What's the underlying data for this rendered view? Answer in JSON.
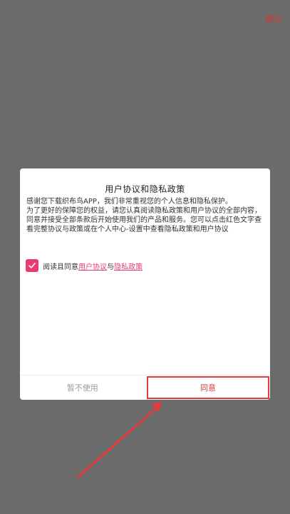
{
  "header": {
    "skip_label": "跳过"
  },
  "dialog": {
    "title": "用户协议和隐私政策",
    "paragraph1": "感谢您下载织布鸟APP，我们非常重视您的个人信息和隐私保护。",
    "paragraph2": "为了更好的保障您的权益，请您认真阅读隐私政策和用户协议的全部内容，同意并接受全部条款后开始使用我们的产品和服务。您可以点击红色文字查看完整协议与政策或在个人中心-设置中查看隐私政策和用户协议",
    "consent": {
      "prefix": "阅读且同意",
      "user_agreement": "用户协议",
      "connector": "与",
      "privacy_policy": "隐私政策",
      "checked": true
    },
    "buttons": {
      "decline": "暂不使用",
      "agree": "同意"
    }
  },
  "colors": {
    "overlay": "#6b6b6b",
    "accent": "#e93d6f",
    "highlight": "#e23c3c"
  }
}
